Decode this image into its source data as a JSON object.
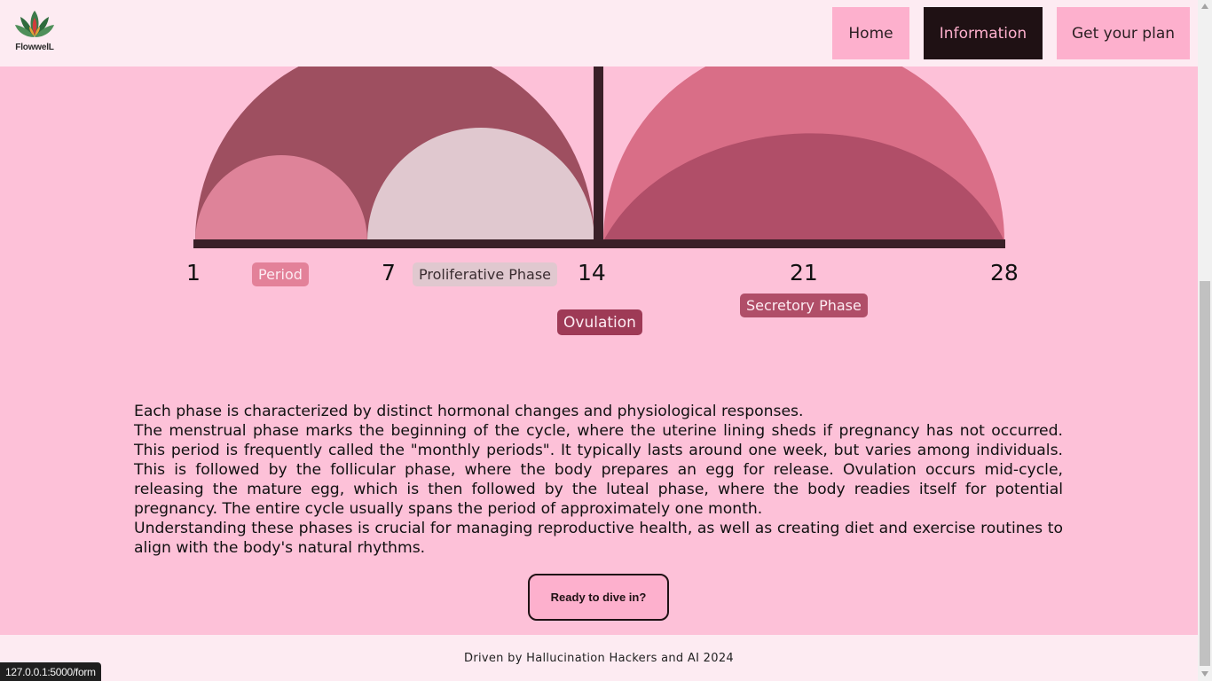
{
  "brand": {
    "name": "FlowwelL"
  },
  "nav": {
    "home": "Home",
    "information": "Information",
    "plan": "Get your plan"
  },
  "cycle": {
    "days": [
      "1",
      "7",
      "14",
      "21",
      "28"
    ],
    "phases": {
      "period": "Period",
      "proliferative": "Proliferative Phase",
      "ovulation": "Ovulation",
      "secretory": "Secretory Phase"
    }
  },
  "content": {
    "p1": "Each phase is characterized by distinct hormonal changes and physiological responses.",
    "p2": "The menstrual phase marks the beginning of the cycle, where the uterine lining sheds if pregnancy has not occurred. This period is frequently called the \"monthly periods\". It typically lasts around one week, but varies among individuals. This is followed by the follicular phase, where the body prepares an egg for release. Ovulation occurs mid-cycle, releasing the mature egg, which is then followed by the luteal phase, where the body readies itself for potential pregnancy. The entire cycle usually spans the period of approximately one month.",
    "p3": "Understanding these phases is crucial for managing reproductive health, as well as creating diet and exercise routines to align with the body's natural rhythms."
  },
  "cta": {
    "label": "Ready to dive in?"
  },
  "footer": {
    "text": "Driven by Hallucination Hackers and AI  2024"
  },
  "status_bar": {
    "url": "127.0.0.1:5000/form"
  },
  "colors": {
    "page_bg": "#fdc1d8",
    "nav_bg": "#fdebf2",
    "nav_button": "#fdb0cd",
    "nav_active": "#1f1114",
    "arc_large_left": "#9e4f60",
    "arc_period": "#de8399",
    "arc_proliferative": "#e0c8cf",
    "arc_large_right": "#d96e87",
    "arc_secretory": "#b04e68",
    "axis": "#3a2028"
  }
}
